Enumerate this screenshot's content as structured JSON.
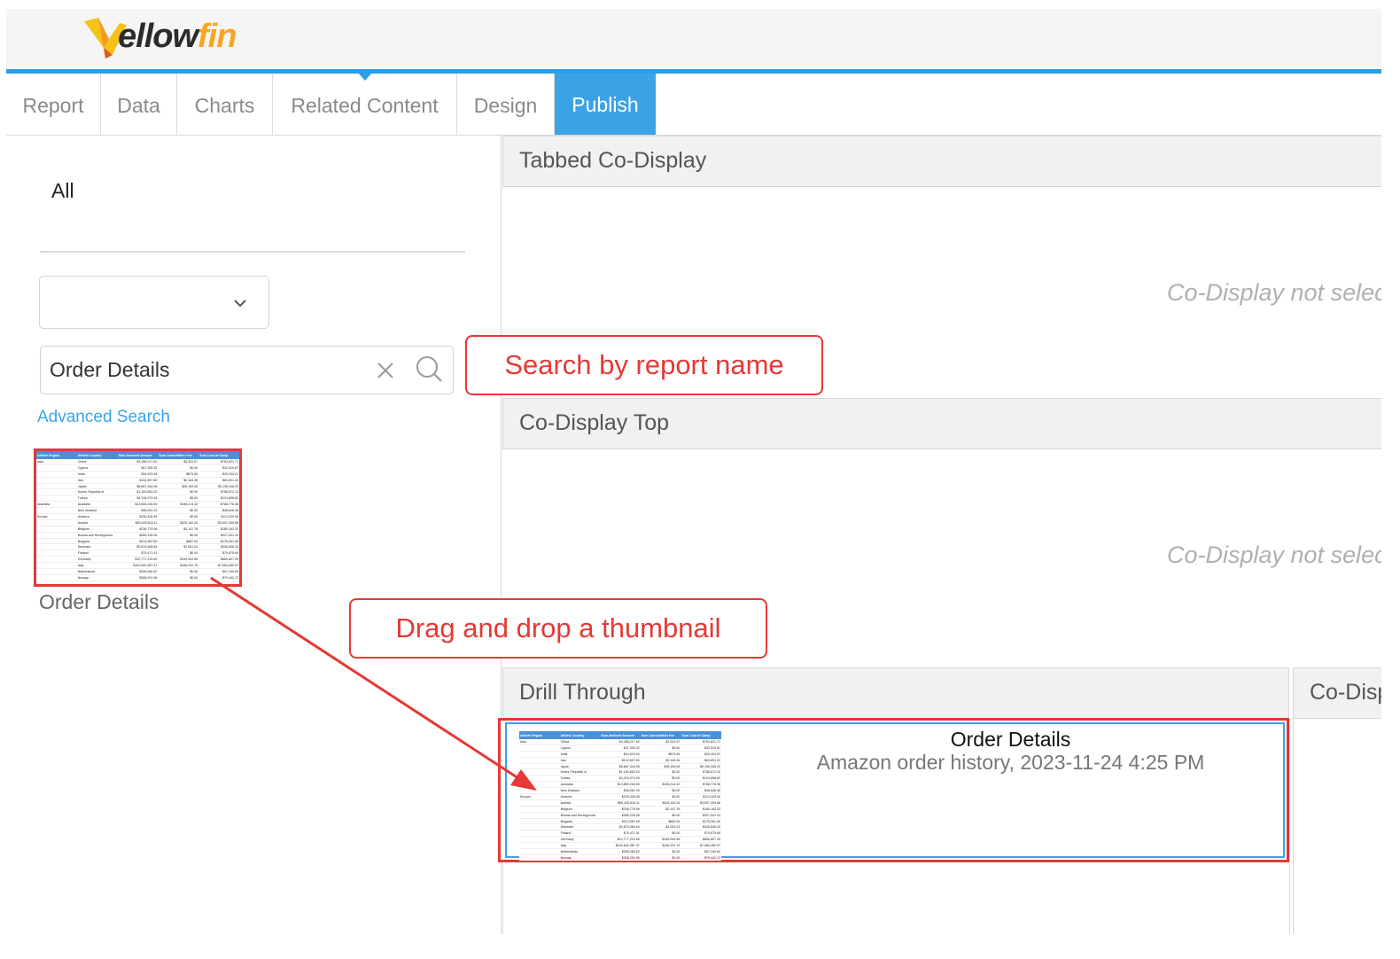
{
  "logo": {
    "text_main": "ellow",
    "text_accent": "fin"
  },
  "tabs": [
    {
      "label": "Report"
    },
    {
      "label": "Data"
    },
    {
      "label": "Charts"
    },
    {
      "label": "Related Content"
    },
    {
      "label": "Design"
    },
    {
      "label": "Publish",
      "active": true
    }
  ],
  "left": {
    "category_label": "All",
    "filter_select_value": "",
    "search_value": "Order Details",
    "advanced_search_label": "Advanced Search",
    "thumbnail_caption": "Order Details"
  },
  "panels": {
    "tabbed_title": "Tabbed Co-Display",
    "tabbed_empty": "Co-Display not selec",
    "top_title": "Co-Display Top",
    "top_empty": "Co-Display not selec",
    "drill_title": "Drill Through",
    "codisp_title": "Co-Disp"
  },
  "drill_item": {
    "title": "Order Details",
    "subtitle": "Amazon order history, 2023-11-24 4:25 PM"
  },
  "callouts": {
    "search": "Search by report name",
    "drag": "Drag and drop a thumbnail"
  },
  "thumbnail_table": {
    "headers": [
      "Athlete Region",
      "Athlete Country",
      "Sum Invoiced Amount",
      "Sum Cancellation Fee",
      "Sum Cost of Camp"
    ],
    "rows": [
      [
        "Asia",
        "China",
        "$3,288,217.62",
        "$3,322.67",
        "$763,621.71"
      ],
      [
        "",
        "Cyprus",
        "$47,395.32",
        "$0.00",
        "$42,519.67"
      ],
      [
        "",
        "India",
        "$34,923.94",
        "$873.65",
        "$25,204.21"
      ],
      [
        "",
        "Iran",
        "$132,597.60",
        "$2,163.36",
        "$63,891.02"
      ],
      [
        "",
        "Japan",
        "$6,667,344.06",
        "$28,169.06",
        "$5,196,346.20"
      ],
      [
        "",
        "Korea, Republic of",
        "$1,183,863.20",
        "$0.00",
        "$788,672.10"
      ],
      [
        "",
        "Turkey",
        "$4,216,374.94",
        "$0.00",
        "$124,898.82"
      ],
      [
        "Australia",
        "Australia",
        "$13,853,226.59",
        "$198,214.42",
        "$788,776.36"
      ],
      [
        "",
        "New Zealand",
        "$36,061.03",
        "$0.00",
        "$48,846.36"
      ],
      [
        "Europe",
        "Andorra",
        "$230,428.45",
        "$0.00",
        "$114,329.06"
      ],
      [
        "",
        "Austria",
        "$50,449,616.11",
        "$325,162.26",
        "$3,697,399.88"
      ],
      [
        "",
        "Belgium",
        "$236,779.06",
        "$2,147.76",
        "$180,163.32"
      ],
      [
        "",
        "Bosnia and Herzegovina",
        "$280,226.06",
        "$0.00",
        "$327,041.33"
      ],
      [
        "",
        "Bulgaria",
        "$213,387.69",
        "$862.53",
        "$176,261.06"
      ],
      [
        "",
        "Denmark",
        "$2,874,069.64",
        "$1,061.03",
        "$326,846.33"
      ],
      [
        "",
        "Finland",
        "$75,471.41",
        "$0.00",
        "$79,875.69"
      ],
      [
        "",
        "Germany",
        "$12,777,219.69",
        "$149,944.96",
        "$669,807.39"
      ],
      [
        "",
        "Italy",
        "$102,642,387.37",
        "$196,222.75",
        "$7,065,350.57"
      ],
      [
        "",
        "Netherlands",
        "$306,080.62",
        "$0.00",
        "$97,340.69"
      ],
      [
        "",
        "Norway",
        "$308,291.96",
        "$0.00",
        "$79,442.72"
      ]
    ]
  }
}
